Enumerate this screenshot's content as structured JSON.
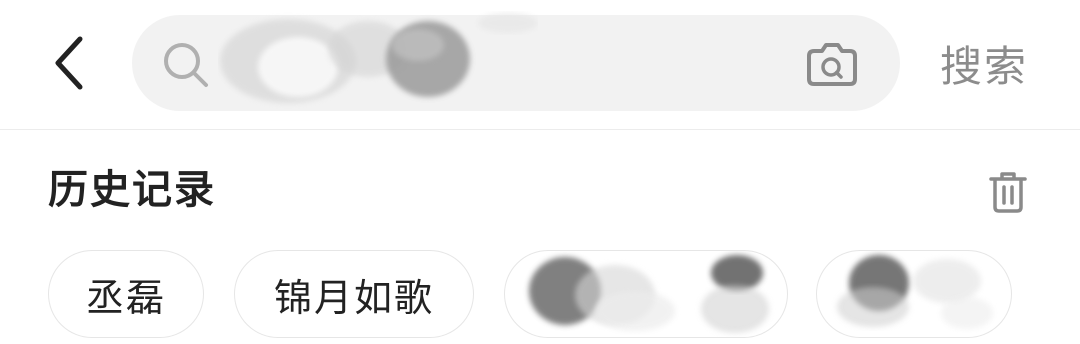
{
  "search": {
    "placeholder": "",
    "submit_label": "搜索"
  },
  "history": {
    "title": "历史记录",
    "items": [
      {
        "label": "丞磊"
      },
      {
        "label": "锦月如歌"
      },
      {
        "label": ""
      },
      {
        "label": ""
      }
    ]
  },
  "icons": {
    "back": "chevron-left-icon",
    "search": "search-icon",
    "camera": "camera-icon",
    "delete": "trash-icon"
  },
  "colors": {
    "search_bg": "#f2f2f2",
    "muted_text": "#8c8c8c",
    "icon_gray": "#8a8a8a",
    "title_text": "#222222"
  }
}
